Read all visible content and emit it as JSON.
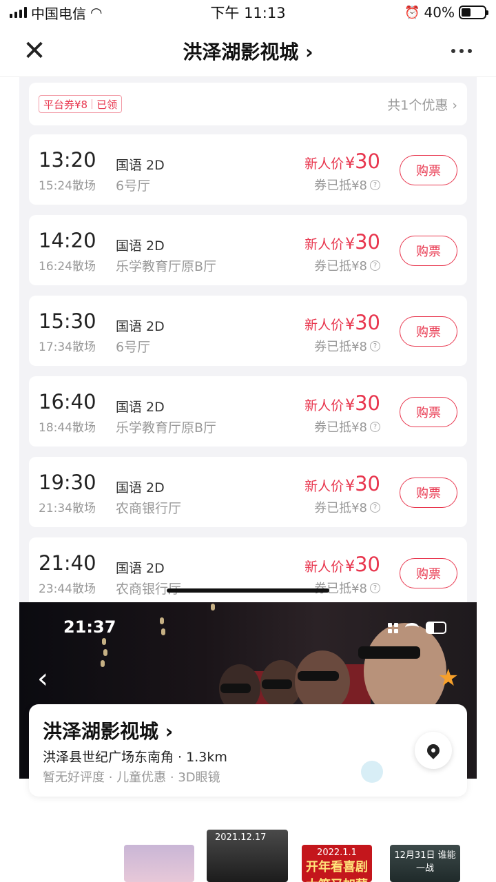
{
  "status_bar": {
    "carrier": "中国电信",
    "time": "下午 11:13",
    "battery": "40%",
    "battery_level": 0.4
  },
  "nav": {
    "title": "洪泽湖影视城 ›"
  },
  "coupon": {
    "label": "平台券¥8",
    "state": "已领",
    "more": "共1个优惠 ›"
  },
  "sessions": [
    {
      "time": "13:20",
      "end": "15:24散场",
      "lang": "国语 2D",
      "hall": "6号厅",
      "price_label": "新人价",
      "currency": "¥",
      "price": "30",
      "discount": "券已抵¥8",
      "buy": "购票"
    },
    {
      "time": "14:20",
      "end": "16:24散场",
      "lang": "国语 2D",
      "hall": "乐学教育厅原B厅",
      "price_label": "新人价",
      "currency": "¥",
      "price": "30",
      "discount": "券已抵¥8",
      "buy": "购票"
    },
    {
      "time": "15:30",
      "end": "17:34散场",
      "lang": "国语 2D",
      "hall": "6号厅",
      "price_label": "新人价",
      "currency": "¥",
      "price": "30",
      "discount": "券已抵¥8",
      "buy": "购票"
    },
    {
      "time": "16:40",
      "end": "18:44散场",
      "lang": "国语 2D",
      "hall": "乐学教育厅原B厅",
      "price_label": "新人价",
      "currency": "¥",
      "price": "30",
      "discount": "券已抵¥8",
      "buy": "购票"
    },
    {
      "time": "19:30",
      "end": "21:34散场",
      "lang": "国语 2D",
      "hall": "农商银行厅",
      "price_label": "新人价",
      "currency": "¥",
      "price": "30",
      "discount": "券已抵¥8",
      "buy": "购票"
    },
    {
      "time": "21:40",
      "end": "23:44散场",
      "lang": "国语 2D",
      "hall": "农商银行厅",
      "price_label": "新人价",
      "currency": "¥",
      "price": "30",
      "discount": "券已抵¥8",
      "buy": "购票"
    }
  ],
  "embedded": {
    "time": "21:37",
    "cinema_name": "洪泽湖影视城 ›",
    "address": "洪泽县世纪广场东南角 · 1.3km",
    "tags": "暂无好评度 · 儿童优惠 · 3D眼镜",
    "posters": [
      {
        "date": "",
        "title": ""
      },
      {
        "date": "2021.12.17",
        "title": ""
      },
      {
        "date": "2022.1.1",
        "title": "开年看喜剧 大笑又加薪"
      },
      {
        "date": "12月31日 谁能一战",
        "title": ""
      }
    ]
  },
  "colors": {
    "accent": "#e8364e",
    "star": "#f7a02a"
  }
}
